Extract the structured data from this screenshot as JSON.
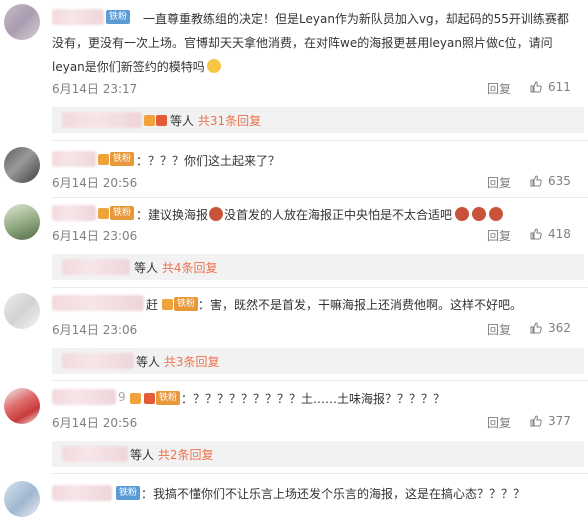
{
  "comments": [
    {
      "fan_badge": "铁粉",
      "lines": [
        "一直尊重教练组的决定！但是Leyan作为新队员加入vg，却起码的55开训练赛都",
        "没有，更没有一次上场。官博却天天拿他消费，在对阵we的海报更甚用leyan照片做c位，请问",
        "leyan是你们新签约的模特吗"
      ],
      "time": "6月14日 23:17",
      "reply_label": "回复",
      "likes": "611",
      "sub_suffix": "等人",
      "sub_link": "共31条回复"
    },
    {
      "fan_badge": "铁粉",
      "lines": [
        "：？？？你们这土起来了？"
      ],
      "time": "6月14日 20:56",
      "reply_label": "回复",
      "likes": "635"
    },
    {
      "fan_badge": "铁粉",
      "lines": [
        "：建议换海报",
        "没首发的人放在海报正中央怕是不太合适吧"
      ],
      "time": "6月14日 23:06",
      "reply_label": "回复",
      "likes": "418",
      "sub_suffix": "等人",
      "sub_link": "共4条回复"
    },
    {
      "name_tail": "赶",
      "fan_badge": "铁粉",
      "lines": [
        "：害，既然不是首发，干嘛海报上还消费他啊。这样不好吧。"
      ],
      "time": "6月14日 23:06",
      "reply_label": "回复",
      "likes": "362",
      "sub_suffix": "等人",
      "sub_link": "共3条回复"
    },
    {
      "name_tail": "9",
      "fan_badge": "铁粉",
      "lines": [
        "：？？？？？？？？？土……土味海报？？？？？"
      ],
      "time": "6月14日 20:56",
      "reply_label": "回复",
      "likes": "377",
      "sub_suffix": "等人",
      "sub_link": "共2条回复"
    },
    {
      "fan_badge": "铁粉",
      "lines": [
        "：我搞不懂你们不让乐言上场还发个乐言的海报，这是在搞心态？？？？"
      ]
    }
  ]
}
